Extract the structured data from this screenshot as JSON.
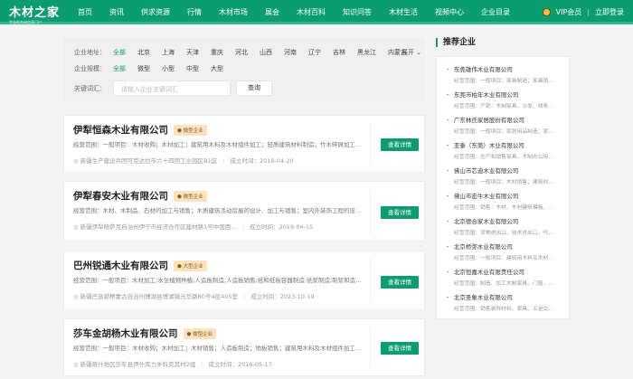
{
  "header": {
    "logo": "木材之家",
    "slogan": "专业的木材信息门户",
    "nav": [
      "首页",
      "资讯",
      "供求资源",
      "行情",
      "木材市场",
      "展会",
      "木材百科",
      "知识问答",
      "木材生活",
      "视频中心",
      "企业目录"
    ],
    "vip": "VIP会员",
    "login": "立即登录"
  },
  "filter": {
    "region_label": "企业地址：",
    "regions": [
      "全部",
      "北京",
      "上海",
      "天津",
      "重庆",
      "河北",
      "山西",
      "河南",
      "辽宁",
      "吉林",
      "黑龙江",
      "内蒙古"
    ],
    "expand": "展开",
    "scale_label": "企业规模：",
    "scales": [
      "全部",
      "微型",
      "小型",
      "中型",
      "大型"
    ],
    "keyword_label": "关键词汇：",
    "keyword_placeholder": "请输入企业关键词汇",
    "search": "查询"
  },
  "companies": [
    {
      "name": "伊犁恒森木业有限公司",
      "badge": "微型企业",
      "scope": "经营范围：一般项目：木材收购；木材加工；建筑用木料及木材组件加工；轻质建筑材料制造；竹木碎屑加工…",
      "address": "新疆生产建设兵团可克达拉市六十四团工业园区B1区",
      "date": "成立时间：2016-04-20",
      "button": "查看详情"
    },
    {
      "name": "伊犁春安木业有限公司",
      "badge": "微型企业",
      "scope": "经营范围：木材、木制品、石材的加工与销售；木质建筑活动房屋的设计、加工与销售；室内外装饰工程的设…",
      "address": "新疆伊犁哈萨克自治州伊宁市经济合作区建材路1号中国西…",
      "date": "成立时间：2019-04-15",
      "button": "查看详情"
    },
    {
      "name": "巴州锐通木业有限公司",
      "badge": "大型企业",
      "scope": "经营范围：一般项目：木材加工;水生植物种植;人造板制造;人造板销售;纸和纸板容器制造;纸浆制造;制浆和造…",
      "address": "新疆巴音郭楞蒙古自治州博湖县博湖镇光华路80号4层405室",
      "date": "成立时间：2023-10-19",
      "button": "查看详情"
    },
    {
      "name": "莎车金胡杨木业有限公司",
      "badge": "微型企业",
      "scope": "经营范围：一般项目：木材收购；木材加工；木材销售；人造板制造；地板销售；建筑用木料及木材组件加工…",
      "address": "新疆喀什地区莎车县伊什库力乡科克其村2组",
      "date": "成立时间：2016-05-17",
      "button": "查看详情"
    }
  ],
  "sidebar": {
    "title": "推荐企业",
    "items": [
      {
        "name": "东莞雄伟木业有限公司",
        "desc": "经营范围：一般项目：家具制造；家具销…"
      },
      {
        "name": "东莞市柏年木业有限公司",
        "desc": "经营范围：产销：木制家具、沙发、线条…"
      },
      {
        "name": "广东林氏家居股份有限公司",
        "desc": "经营范围：一般项目：家居用品制造；家…"
      },
      {
        "name": "亚泰（东莞）木业有限公司",
        "desc": "经营范围：生产和销售家具、木制办公用…"
      },
      {
        "name": "佛山市芯迪木业有限公司",
        "desc": "经营范围：一般项目：木材销售；建筑材…"
      },
      {
        "name": "佛山市宏牛木业有限公司",
        "desc": "经营范围：销售：木材、木材建筑模板、…"
      },
      {
        "name": "北京德合家木业有限公司",
        "desc": "经营范围：货物进出口、技术进出口、代…"
      },
      {
        "name": "北京桥弥木业有限公司",
        "desc": "经营范围：一般项目：建筑用木料及木材…"
      },
      {
        "name": "北京恒嘉木业有限责任公司",
        "desc": "经营范围：制造、加工木制家具、门窗、…"
      },
      {
        "name": "北京圣象木业有限公司",
        "desc": "经营范围：销售装饰材料、家具、五金交…"
      }
    ]
  }
}
